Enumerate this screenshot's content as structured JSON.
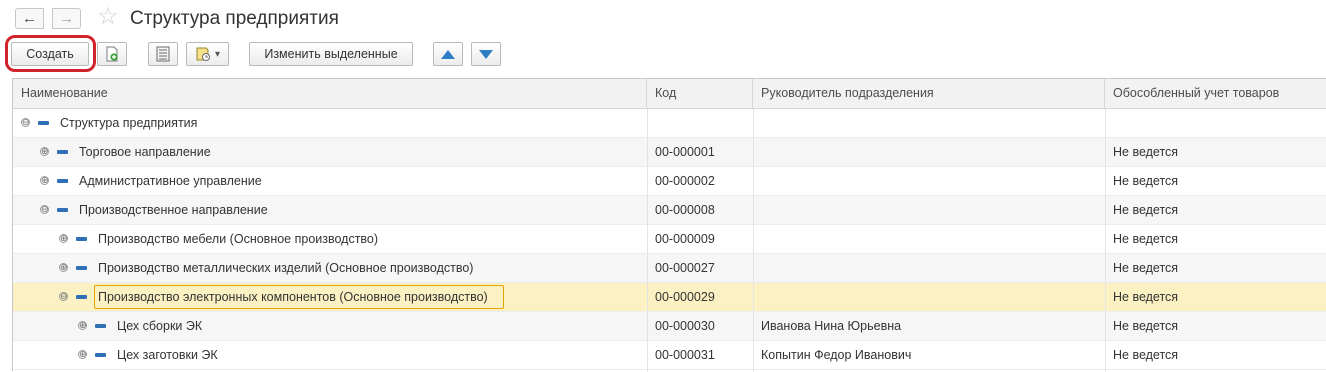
{
  "window": {
    "title": "Структура предприятия"
  },
  "nav": {
    "back_icon": "←",
    "forward_icon": "→",
    "favorite_icon": "☆"
  },
  "toolbar": {
    "create_label": "Создать",
    "edit_selected_label": "Изменить выделенные",
    "report_dropdown_icon": "▾"
  },
  "columns": [
    "Наименование",
    "Код",
    "Руководитель подразделения",
    "Обособленный учет товаров"
  ],
  "rows": [
    {
      "level": 0,
      "toggle": "⊖",
      "name": "Структура предприятия",
      "code": "",
      "manager": "",
      "separate": ""
    },
    {
      "level": 1,
      "toggle": "⊕",
      "name": "Торговое направление",
      "code": "00-000001",
      "manager": "",
      "separate": "Не ведется"
    },
    {
      "level": 1,
      "toggle": "⊕",
      "name": "Административное управление",
      "code": "00-000002",
      "manager": "",
      "separate": "Не ведется"
    },
    {
      "level": 1,
      "toggle": "⊖",
      "name": "Производственное направление",
      "code": "00-000008",
      "manager": "",
      "separate": "Не ведется"
    },
    {
      "level": 2,
      "toggle": "⊕",
      "name": "Производство мебели (Основное производство)",
      "code": "00-000009",
      "manager": "",
      "separate": "Не ведется"
    },
    {
      "level": 2,
      "toggle": "⊕",
      "name": "Производство металлических изделий (Основное производство)",
      "code": "00-000027",
      "manager": "",
      "separate": "Не ведется"
    },
    {
      "level": 2,
      "toggle": "⊖",
      "name": "Производство электронных компонентов (Основное производство)",
      "code": "00-000029",
      "manager": "",
      "separate": "Не ведется",
      "selected": true
    },
    {
      "level": 3,
      "toggle": "⊕",
      "name": "Цех сборки ЭК",
      "code": "00-000030",
      "manager": "Иванова Нина Юрьевна",
      "separate": "Не ведется"
    },
    {
      "level": 3,
      "toggle": "⊕",
      "name": "Цех заготовки ЭК",
      "code": "00-000031",
      "manager": "Копытин Федор Иванович",
      "separate": "Не ведется"
    }
  ],
  "colors": {
    "selected_row": "#fbf1c3",
    "selected_border": "#e8a100",
    "tree_mark": "#2f6fb6",
    "highlight_ring": "#d2232a"
  }
}
